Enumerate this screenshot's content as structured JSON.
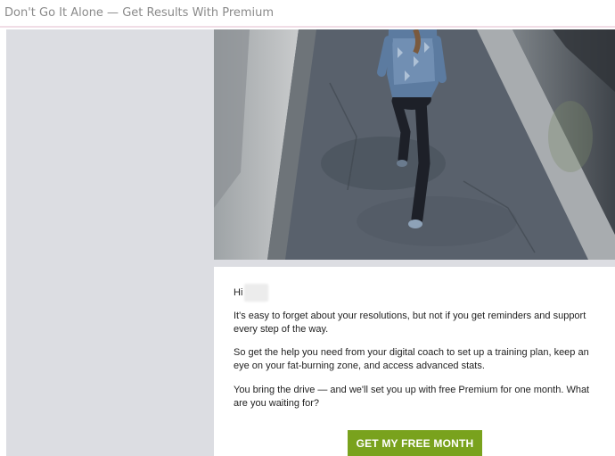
{
  "email": {
    "subject": "Don't Go It Alone — Get Results With Premium"
  },
  "body": {
    "greeting": "Hi",
    "paragraphs": [
      "It's easy to forget about your resolutions, but not if you get reminders and support every step of the way.",
      "So get the help you need from your digital coach to set up a training plan, keep an eye on your fat-burning zone, and access advanced stats.",
      "You bring the drive — and we'll set you up with free Premium for one month. What are you waiting for?"
    ],
    "cta_label": "GET MY FREE MONTH"
  },
  "colors": {
    "cta_background": "#79a21d",
    "sidebar": "#dcdde2",
    "subject_text": "#8a8a8a"
  },
  "icons": {
    "hero": "runner-photo"
  }
}
